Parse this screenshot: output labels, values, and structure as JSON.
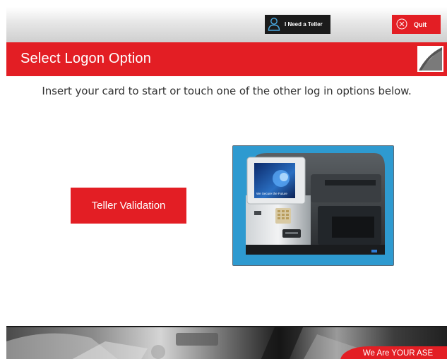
{
  "topbar": {
    "teller_button_label": "I Need a Teller",
    "quit_button_label": "Quit"
  },
  "header": {
    "title": "Select Logon Option"
  },
  "main": {
    "instructions": "Insert your card to start or touch one of the other log in options below.",
    "teller_validation_label": "Teller Validation",
    "kiosk_screen_text": "We Secure the Future"
  },
  "footer": {
    "tagline": "We Are YOUR ASE"
  },
  "colors": {
    "accent_red": "#e31e24",
    "dark": "#1b1b1b",
    "kiosk_bg": "#2e9ad0"
  },
  "icons": {
    "teller": "person-icon",
    "quit": "close-circle-icon",
    "logo": "brand-logo"
  }
}
